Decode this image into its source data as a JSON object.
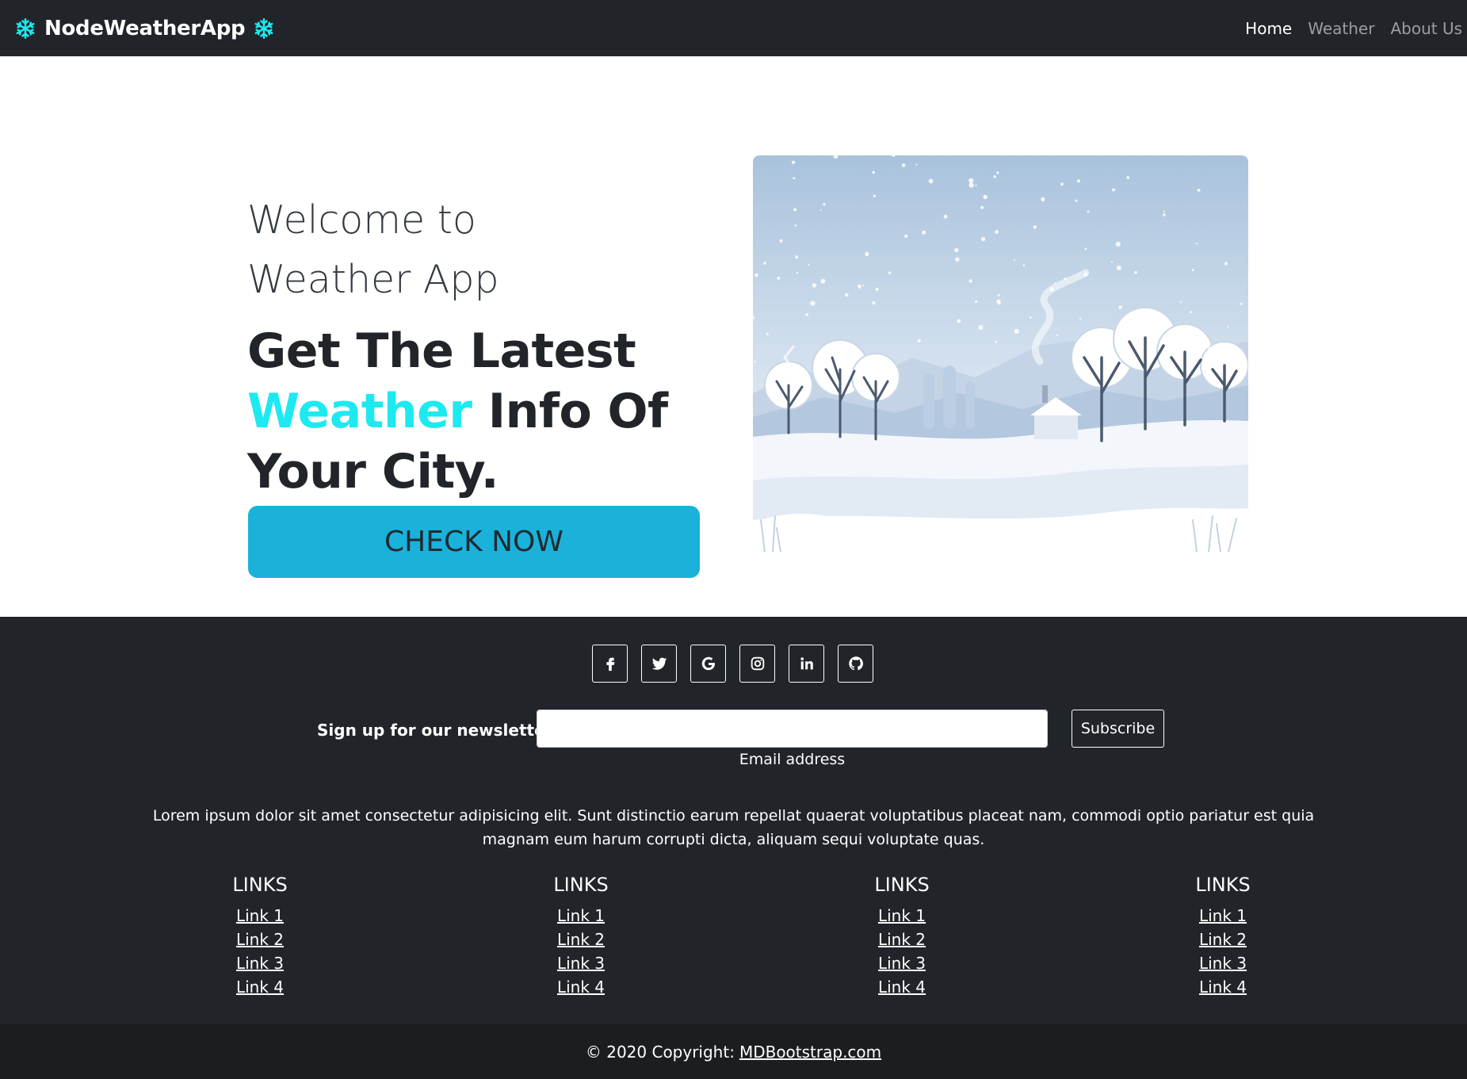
{
  "navbar": {
    "brand": "NodeWeatherApp",
    "brand_icon": "snowflake-icon",
    "brand_icon_color": "#1de9f0",
    "links": [
      {
        "label": "Home",
        "active": true
      },
      {
        "label": "Weather",
        "active": false
      },
      {
        "label": "About Us",
        "active": false
      }
    ]
  },
  "hero": {
    "welcome_line1": "Welcome to",
    "welcome_line2": "Weather App",
    "headline_part1": "Get The Latest",
    "headline_accent": "Weather",
    "headline_part2": "Info Of",
    "headline_part3": "Your City.",
    "accent_color": "#1de9f0",
    "cta_label": "CHECK NOW",
    "cta_color": "#1ab2db",
    "image": "winter-landscape-illustration"
  },
  "footer": {
    "socials": [
      "facebook-icon",
      "twitter-icon",
      "google-icon",
      "instagram-icon",
      "linkedin-icon",
      "github-icon"
    ],
    "newsletter_label": "Sign up for our newsletter",
    "email_value": "",
    "email_help": "Email address",
    "subscribe_label": "Subscribe",
    "lorem": "Lorem ipsum dolor sit amet consectetur adipisicing elit. Sunt distinctio earum repellat quaerat voluptatibus placeat nam, commodi optio pariatur est quia magnam eum harum corrupti dicta, aliquam sequi voluptate quas.",
    "link_columns": [
      {
        "title": "LINKS",
        "links": [
          "Link 1",
          "Link 2",
          "Link 3",
          "Link 4"
        ]
      },
      {
        "title": "LINKS",
        "links": [
          "Link 1",
          "Link 2",
          "Link 3",
          "Link 4"
        ]
      },
      {
        "title": "LINKS",
        "links": [
          "Link 1",
          "Link 2",
          "Link 3",
          "Link 4"
        ]
      },
      {
        "title": "LINKS",
        "links": [
          "Link 1",
          "Link 2",
          "Link 3",
          "Link 4"
        ]
      }
    ],
    "copyright_prefix": "© 2020 Copyright:",
    "copyright_link": "MDBootstrap.com"
  }
}
